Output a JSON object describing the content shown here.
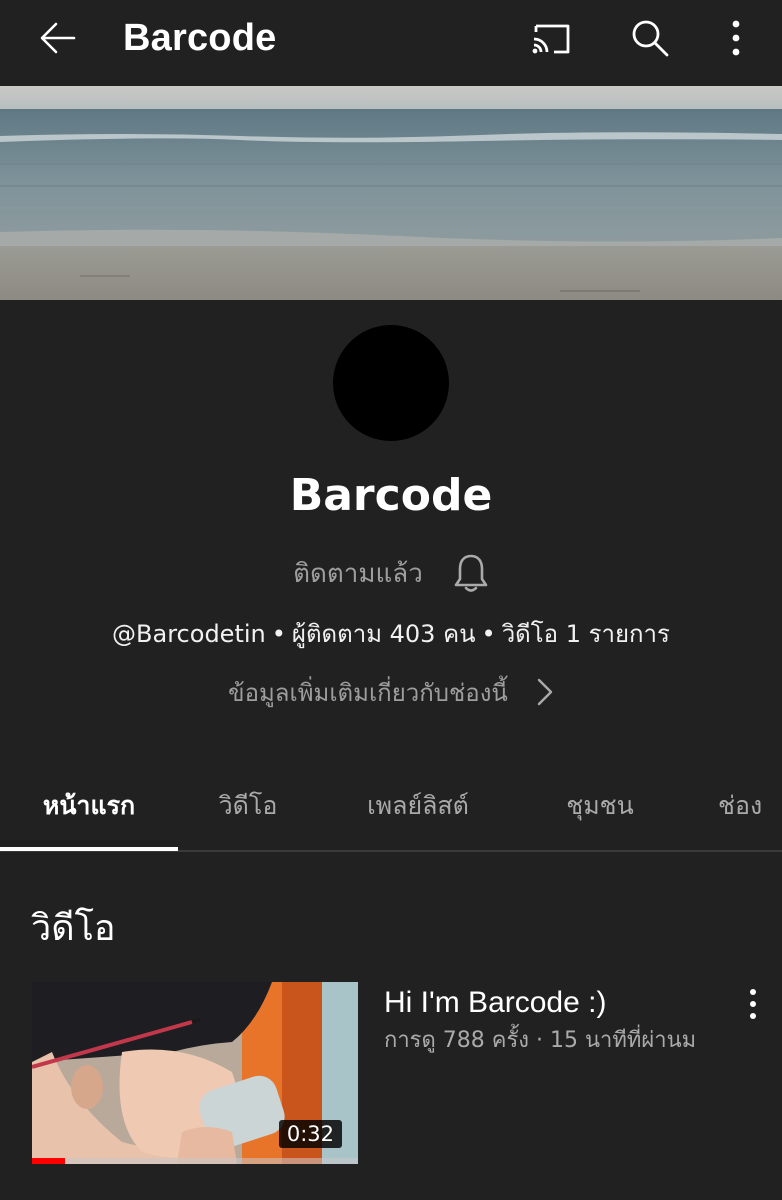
{
  "appbar": {
    "title": "Barcode",
    "icons": [
      "arrow-back-icon",
      "cast-icon",
      "search-icon",
      "more-vertical-icon"
    ]
  },
  "channel": {
    "name": "Barcode",
    "subscribe_status": "ติดตามแล้ว",
    "handle": "@Barcodetin",
    "subscribers": "ผู้ติดตาม 403 คน",
    "video_count": "วิดีโอ 1 รายการ",
    "separator": "•",
    "about": "ข้อมูลเพิ่มเติมเกี่ยวกับช่องนี้"
  },
  "tabs": [
    {
      "label": "หน้าแรก",
      "active": true
    },
    {
      "label": "วิดีโอ",
      "active": false
    },
    {
      "label": "เพลย์ลิสต์",
      "active": false
    },
    {
      "label": "ชุมชน",
      "active": false
    },
    {
      "label": "ช่อง",
      "active": false
    }
  ],
  "section": {
    "title": "วิดีโอ"
  },
  "videos": [
    {
      "title": "Hi I'm Barcode :)",
      "meta": "การดู 788 ครั้ง · 15 นาทีที่ผ่านม",
      "duration": "0:32",
      "watched_fraction": 0.1
    }
  ],
  "colors": {
    "background": "#212121",
    "text_primary": "#ffffff",
    "text_secondary": "#aaaaaa",
    "progress": "#ff0000"
  }
}
